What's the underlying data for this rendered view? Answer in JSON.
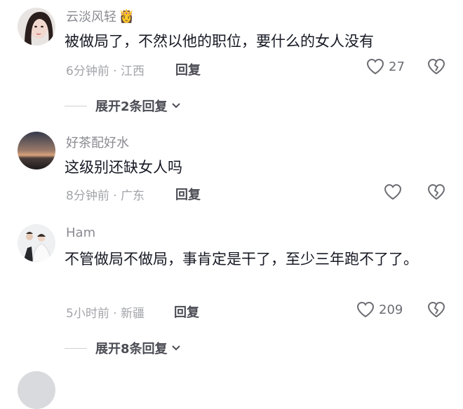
{
  "comments": [
    {
      "username": "云淡风轻",
      "username_emoji": "👸",
      "text": "被做局了，不然以他的职位，要什么的女人没有",
      "time": "6分钟前",
      "location": "江西",
      "reply_label": "回复",
      "likes": "27",
      "avatar": "woman-portrait"
    },
    {
      "username": "好茶配好水",
      "text": "这级别还缺女人吗",
      "time": "8分钟前",
      "location": "广东",
      "reply_label": "回复",
      "likes": "",
      "avatar": "sunset-landscape"
    },
    {
      "username": "Ham",
      "text": "不管做局不做局，事肯定是干了，至少三年跑不了了。",
      "time": "5小时前",
      "location": "新疆",
      "reply_label": "回复",
      "likes": "209",
      "avatar": "wedding-couple"
    }
  ],
  "expand_1": "展开2条回复",
  "expand_2": "展开8条回复",
  "meta_separator": "·",
  "colors": {
    "text_primary": "#161823",
    "text_secondary": "#8a8b91",
    "icon_gray": "#6c6d73"
  }
}
